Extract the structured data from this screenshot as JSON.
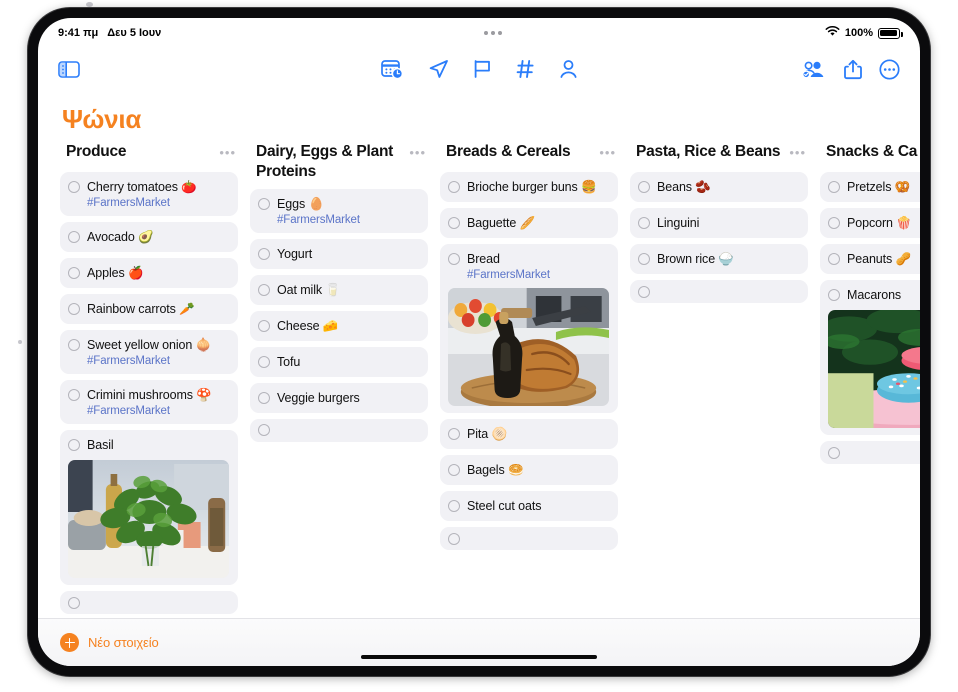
{
  "status_bar": {
    "time": "9:41 πμ",
    "date": "Δευ 5 Ιουν",
    "wifi_icon": "wifi-icon",
    "battery_percent": "100%",
    "battery_icon": "battery-full-icon",
    "multitask_dots": "multitasking-dots"
  },
  "toolbar": {
    "sidebar_toggle_icon": "sidebar-toggle-icon",
    "center_items": [
      {
        "name": "calendar-clock-icon",
        "label": "Reminder date"
      },
      {
        "name": "location-arrow-icon",
        "label": "Location"
      },
      {
        "name": "flag-icon",
        "label": "Flag"
      },
      {
        "name": "hashtag-icon",
        "label": "Tag"
      },
      {
        "name": "person-icon",
        "label": "Assign"
      }
    ],
    "right_items": [
      {
        "name": "collaborate-icon",
        "label": "Collaborate"
      },
      {
        "name": "share-icon",
        "label": "Share"
      },
      {
        "name": "more-circle-icon",
        "label": "More"
      }
    ]
  },
  "page_title": "Ψώνια",
  "accent_color": "#f58220",
  "tint_color": "#2b7dfa",
  "tag_color": "#5b74c8",
  "card_bg": "#f1f1f5",
  "more_glyph": "•••",
  "columns": [
    {
      "title": "Produce",
      "items": [
        {
          "text": "Cherry tomatoes 🍅",
          "tag": "#FarmersMarket"
        },
        {
          "text": "Avocado 🥑"
        },
        {
          "text": "Apples 🍎"
        },
        {
          "text": "Rainbow carrots 🥕"
        },
        {
          "text": "Sweet yellow onion 🧅",
          "tag": "#FarmersMarket"
        },
        {
          "text": "Crimini mushrooms 🍄",
          "tag": "#FarmersMarket"
        },
        {
          "text": "Basil",
          "image": "basil-photo"
        },
        {
          "text": "",
          "empty": true
        }
      ]
    },
    {
      "title": "Dairy, Eggs & Plant Proteins",
      "items": [
        {
          "text": "Eggs 🥚",
          "tag": "#FarmersMarket"
        },
        {
          "text": "Yogurt"
        },
        {
          "text": "Oat milk 🥛"
        },
        {
          "text": "Cheese 🧀"
        },
        {
          "text": "Tofu"
        },
        {
          "text": "Veggie burgers"
        },
        {
          "text": "",
          "empty": true
        }
      ]
    },
    {
      "title": "Breads & Cereals",
      "items": [
        {
          "text": "Brioche burger buns 🍔"
        },
        {
          "text": "Baguette 🥖"
        },
        {
          "text": "Bread",
          "tag": "#FarmersMarket",
          "image": "bread-photo"
        },
        {
          "text": "Pita 🫓"
        },
        {
          "text": "Bagels 🥯"
        },
        {
          "text": "Steel cut oats"
        },
        {
          "text": "",
          "empty": true
        }
      ]
    },
    {
      "title": "Pasta, Rice & Beans",
      "items": [
        {
          "text": "Beans 🫘"
        },
        {
          "text": "Linguini"
        },
        {
          "text": "Brown rice 🍚"
        },
        {
          "text": "",
          "empty": true
        }
      ]
    },
    {
      "title": "Snacks & Ca",
      "items": [
        {
          "text": "Pretzels 🥨"
        },
        {
          "text": "Popcorn 🍿"
        },
        {
          "text": "Peanuts 🥜"
        },
        {
          "text": "Macarons",
          "image": "macarons-photo"
        },
        {
          "text": "",
          "empty": true
        }
      ]
    }
  ],
  "footer": {
    "new_item_label": "Νέο στοιχείο",
    "plus_icon": "plus-circle-icon",
    "home_indicator": "home-indicator"
  }
}
